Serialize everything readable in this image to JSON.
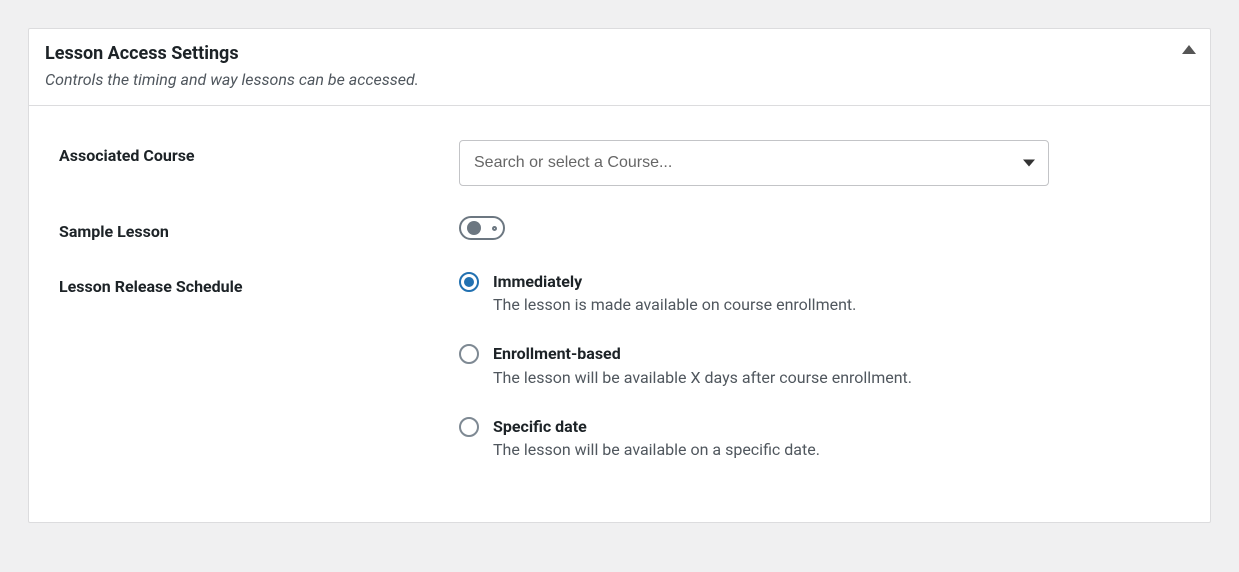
{
  "panel": {
    "title": "Lesson Access Settings",
    "subtitle": "Controls the timing and way lessons can be accessed."
  },
  "fields": {
    "associated_course": {
      "label": "Associated Course",
      "placeholder": "Search or select a Course..."
    },
    "sample_lesson": {
      "label": "Sample Lesson",
      "value": false
    },
    "release_schedule": {
      "label": "Lesson Release Schedule",
      "selected": "immediately",
      "options": [
        {
          "key": "immediately",
          "title": "Immediately",
          "desc": "The lesson is made available on course enrollment."
        },
        {
          "key": "enrollment",
          "title": "Enrollment-based",
          "desc": "The lesson will be available X days after course enrollment."
        },
        {
          "key": "specific",
          "title": "Specific date",
          "desc": "The lesson will be available on a specific date."
        }
      ]
    }
  }
}
